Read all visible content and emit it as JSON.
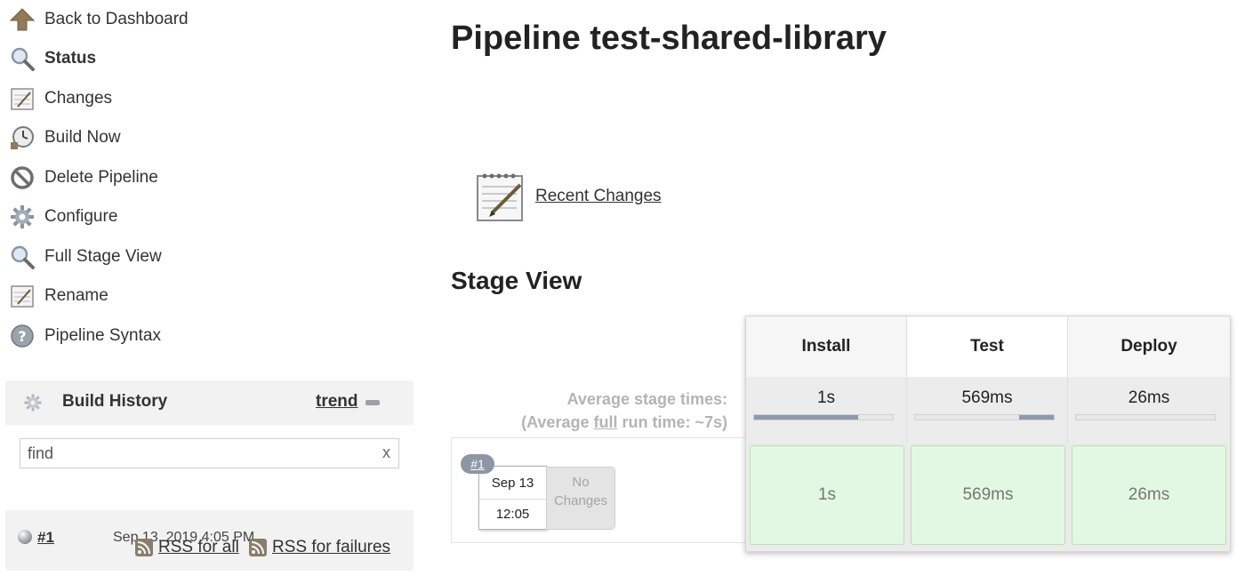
{
  "sidebar": {
    "tasks": [
      {
        "label": "Back to Dashboard",
        "icon": "up-arrow-icon"
      },
      {
        "label": "Status",
        "icon": "magnifier-icon"
      },
      {
        "label": "Changes",
        "icon": "notepad-icon"
      },
      {
        "label": "Build Now",
        "icon": "clock-icon"
      },
      {
        "label": "Delete Pipeline",
        "icon": "no-entry-icon"
      },
      {
        "label": "Configure",
        "icon": "gear-icon"
      },
      {
        "label": "Full Stage View",
        "icon": "magnifier-icon"
      },
      {
        "label": "Rename",
        "icon": "notepad-icon"
      },
      {
        "label": "Pipeline Syntax",
        "icon": "help-icon"
      }
    ]
  },
  "build_history": {
    "title": "Build History",
    "trend": "trend",
    "search_value": "find",
    "clear": "x",
    "builds": [
      {
        "number": "#1",
        "date": "Sep 13, 2019 4:05 PM"
      }
    ],
    "rss_all": "RSS for all",
    "rss_failures": "RSS for failures"
  },
  "main": {
    "title": "Pipeline test-shared-library",
    "recent_changes": "Recent Changes",
    "stage_view_title": "Stage View"
  },
  "stage_view": {
    "avg_label_1": "Average stage times:",
    "avg_label_2_pre": "(Average ",
    "avg_label_2_full": "full",
    "avg_label_2_post": " run time: ~7s)",
    "stages": [
      {
        "name": "Install",
        "avg": "1s",
        "bar_start": 0.0,
        "bar_fill": 0.75
      },
      {
        "name": "Test",
        "avg": "569ms",
        "bar_start": 0.75,
        "bar_fill": 0.25
      },
      {
        "name": "Deploy",
        "avg": "26ms",
        "bar_start": 0.0,
        "bar_fill": 0.0
      }
    ],
    "run": {
      "badge": "#1",
      "date": "Sep 13",
      "time": "12:05",
      "changes": "No Changes",
      "cells": [
        "1s",
        "569ms",
        "26ms"
      ]
    }
  }
}
